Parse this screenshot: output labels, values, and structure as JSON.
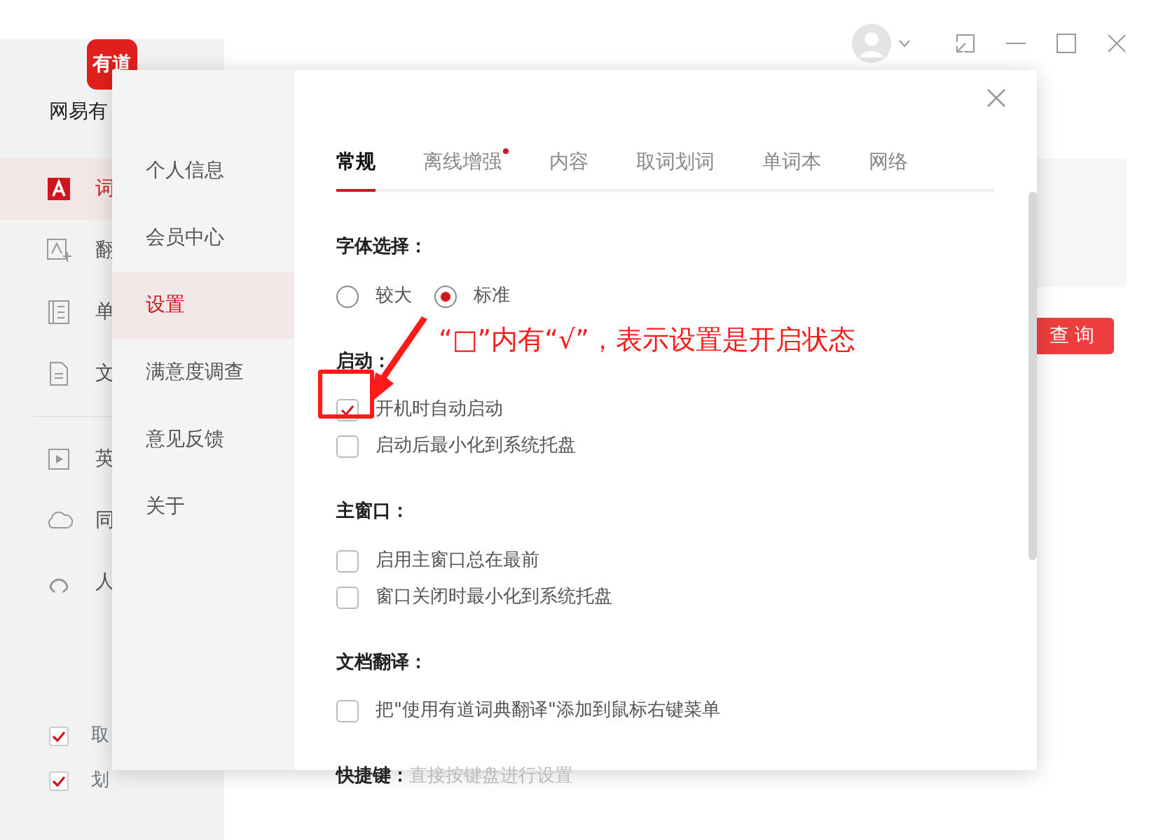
{
  "app": {
    "logo_text": "有道",
    "app_name": "网易有",
    "sidebar": [
      {
        "label": "词",
        "kind": "dict",
        "selected": true
      },
      {
        "label": "翻",
        "kind": "translate",
        "selected": false
      },
      {
        "label": "单",
        "kind": "wordbook",
        "selected": false
      },
      {
        "label": "文",
        "kind": "document",
        "selected": false
      },
      {
        "label": "英",
        "kind": "video",
        "selected": false
      },
      {
        "label": "同",
        "kind": "cloud",
        "selected": false
      },
      {
        "label": "人",
        "kind": "headset",
        "selected": false
      }
    ],
    "bottom_checks": [
      {
        "label": "取",
        "checked": true
      },
      {
        "label": "划",
        "checked": true
      }
    ],
    "search_button": "查 询"
  },
  "dialog": {
    "nav": [
      {
        "label": "个人信息",
        "selected": false
      },
      {
        "label": "会员中心",
        "selected": false
      },
      {
        "label": "设置",
        "selected": true
      },
      {
        "label": "满意度调查",
        "selected": false
      },
      {
        "label": "意见反馈",
        "selected": false
      },
      {
        "label": "关于",
        "selected": false
      }
    ],
    "tabs": [
      {
        "label": "常规",
        "selected": true,
        "dot": false
      },
      {
        "label": "离线增强",
        "selected": false,
        "dot": true
      },
      {
        "label": "内容",
        "selected": false,
        "dot": false
      },
      {
        "label": "取词划词",
        "selected": false,
        "dot": false
      },
      {
        "label": "单词本",
        "selected": false,
        "dot": false
      },
      {
        "label": "网络",
        "selected": false,
        "dot": false
      }
    ],
    "sections": [
      {
        "title": "字体选择：",
        "kind": "radio",
        "options": [
          {
            "label": "较大",
            "selected": false
          },
          {
            "label": "标准",
            "selected": true
          }
        ]
      },
      {
        "title": "启动：",
        "kind": "checkbox",
        "options": [
          {
            "label": "开机时自动启动",
            "checked": true
          },
          {
            "label": "启动后最小化到系统托盘",
            "checked": false
          }
        ]
      },
      {
        "title": "主窗口：",
        "kind": "checkbox",
        "options": [
          {
            "label": "启用主窗口总在最前",
            "checked": false
          },
          {
            "label": "窗口关闭时最小化到系统托盘",
            "checked": false
          }
        ]
      },
      {
        "title": "文档翻译：",
        "kind": "checkbox",
        "options": [
          {
            "label": "把\"使用有道词典翻译\"添加到鼠标右键菜单",
            "checked": false
          }
        ]
      },
      {
        "title": "快捷键：",
        "kind": "hint",
        "hint": "直接按键盘进行设置"
      }
    ]
  },
  "annotation": {
    "text": "“□”内有“√”，表示设置是开启状态"
  }
}
